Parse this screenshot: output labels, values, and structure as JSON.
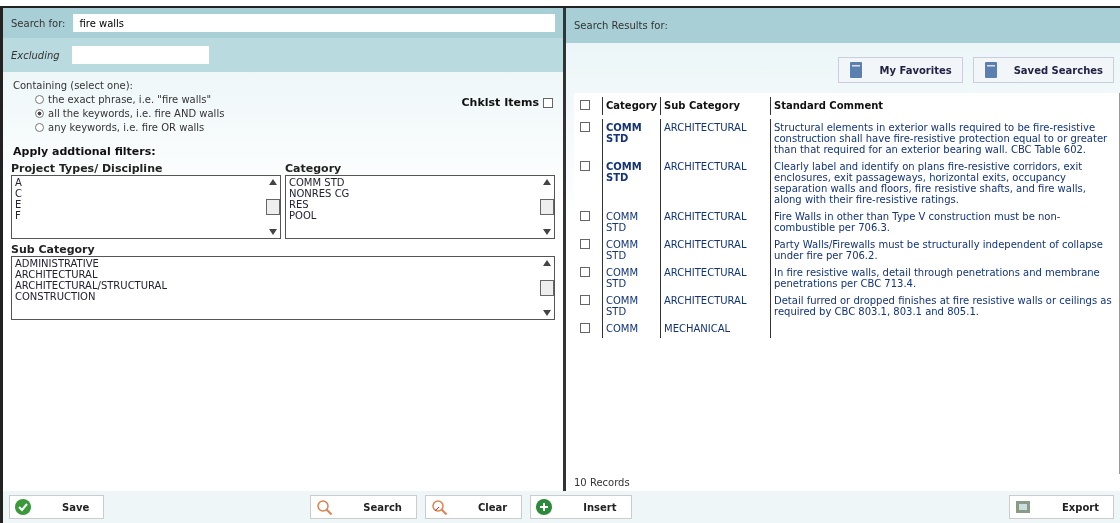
{
  "search": {
    "label": "Search for:",
    "value": "fire walls",
    "excluding_label": "Excluding"
  },
  "containing": {
    "label": "Containing (select one):",
    "options": [
      {
        "label": "the exact phrase, i.e. \"fire walls\"",
        "selected": false
      },
      {
        "label": "all the keywords, i.e. fire AND walls",
        "selected": true
      },
      {
        "label": "any keywords, i.e. fire OR walls",
        "selected": false
      }
    ]
  },
  "checklist": {
    "label": "Chklst Items",
    "checked": false
  },
  "filters": {
    "title": "Apply addtional filters:",
    "project_types": {
      "label": "Project Types/ Discipline",
      "items": [
        "A",
        "C",
        "E",
        "F"
      ]
    },
    "category": {
      "label": "Category",
      "items": [
        "COMM STD",
        "NONRES CG",
        "RES",
        "POOL"
      ]
    },
    "sub_category": {
      "label": "Sub Category",
      "items": [
        "ADMINISTRATIVE",
        "ARCHITECTURAL",
        "ARCHITECTURAL/STRUCTURAL",
        "CONSTRUCTION"
      ]
    }
  },
  "results": {
    "title": "Search Results for:",
    "buttons": [
      {
        "label": "My Favorites"
      },
      {
        "label": "Saved Searches"
      }
    ],
    "select_all_checked": false,
    "columns": [
      "Category",
      "Sub Category",
      "Standard Comment"
    ],
    "rows": [
      {
        "checked": false,
        "category": "COMM STD",
        "sub_category": "ARCHITECTURAL",
        "comment": "Structural elements in exterior walls required to be fire-resistive construction shall have fire-resistive protection equal to or greater than that required for an exterior bearing wall. CBC Table 602."
      },
      {
        "checked": false,
        "category": "COMM STD",
        "sub_category": "ARCHITECTURAL",
        "comment": "Clearly label and identify on plans fire-resistive corridors, exit enclosures, exit passageways, horizontal exits, occupancy separation walls and floors, fire resistive shafts, and fire walls, along with their fire-resistive ratings."
      },
      {
        "checked": false,
        "category": "COMM STD",
        "sub_category": "ARCHITECTURAL",
        "comment": "Fire Walls in other than Type V construction must be non-combustible per 706.3."
      },
      {
        "checked": false,
        "category": "COMM STD",
        "sub_category": "ARCHITECTURAL",
        "comment": "Party Walls/Firewalls must be structurally independent of collapse under fire per 706.2."
      },
      {
        "checked": false,
        "category": "COMM STD",
        "sub_category": "ARCHITECTURAL",
        "comment": "In fire resistive walls, detail through penetrations and membrane penetrations per CBC 713.4."
      },
      {
        "checked": false,
        "category": "COMM STD",
        "sub_category": "ARCHITECTURAL",
        "comment": "Detail furred or dropped finishes at fire resistive walls or ceilings as required by CBC 803.1, 803.1 and 805.1."
      },
      {
        "checked": false,
        "category": "COMM",
        "sub_category": "MECHANICAL"
      }
    ],
    "count": "10 Records"
  },
  "toolbar": [
    {
      "kind": "save",
      "label": "Save"
    },
    {
      "kind": "search",
      "label": "Search"
    },
    {
      "kind": "clear",
      "label": "Clear"
    },
    {
      "kind": "insert",
      "label": "Insert"
    },
    {
      "kind": "export",
      "label": "Export"
    }
  ]
}
